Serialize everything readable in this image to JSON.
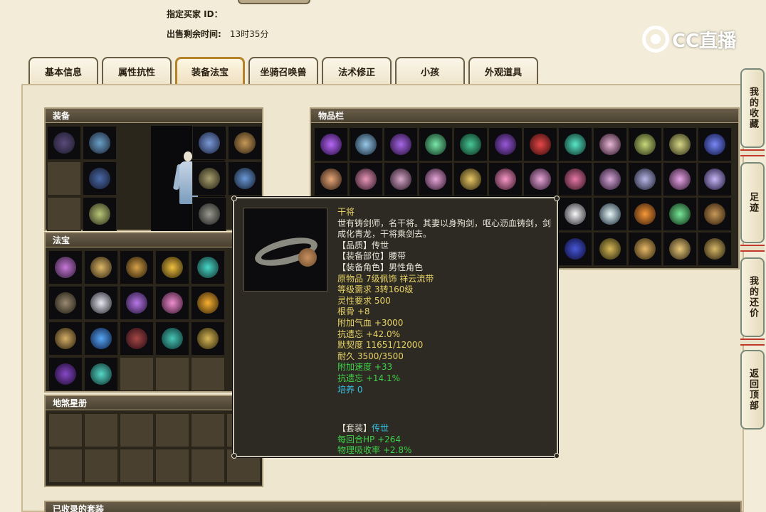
{
  "seller": {
    "buyer_label": "指定买家 ID：",
    "buyer_value": "",
    "time_label": "出售剩余时间:",
    "time_value": "13时35分"
  },
  "logo": {
    "text": "CC直播"
  },
  "tabs": [
    {
      "label": "基本信息"
    },
    {
      "label": "属性抗性"
    },
    {
      "label": "装备法宝",
      "active": true
    },
    {
      "label": "坐骑召唤兽"
    },
    {
      "label": "法术修正"
    },
    {
      "label": "小孩"
    },
    {
      "label": "外观道具"
    }
  ],
  "panels": {
    "equipment": "装备",
    "treasure": "法宝",
    "star_album": "地煞星册",
    "inventory": "物品栏",
    "collected_sets": "已收录的套装"
  },
  "side_buttons": [
    {
      "label": "我的收藏"
    },
    {
      "label": "足迹"
    },
    {
      "label": "我的还价"
    },
    {
      "label": "返回顶部"
    }
  ],
  "tooltip": {
    "name": "干将",
    "desc": "世有铸剑师，名干将。其妻以身殉剑，呕心沥血铸剑，剑成化青龙，干将乘剑去。",
    "quality": "【品质】传世",
    "slot": "【装备部位】腰带",
    "role": "【装备角色】男性角色",
    "origin": "原物品 7级佩饰 祥云流带",
    "level_req": "等级需求 3转160级",
    "spirit_req": "灵性要求 500",
    "stat1": "根骨 +8",
    "stat2": "附加气血 +3000",
    "stat3": "抗遗忘 +42.0%",
    "stat4": "默契度 11651/12000",
    "stat5": "耐久 3500/3500",
    "bonus1": "附加速度 +33",
    "bonus2": "抗遗忘 +14.1%",
    "cultivate": "培养 0",
    "set_label": "【套装】",
    "set_name": "传世",
    "set1": "每回合HP +264",
    "set2": "物理吸收率 +2.8%"
  },
  "colors": {
    "tooltip_name": "#e8d266",
    "tooltip_bonus": "#3fd04a",
    "tooltip_cyan": "#36c0e0",
    "tab_active_border": "#b5822a"
  }
}
